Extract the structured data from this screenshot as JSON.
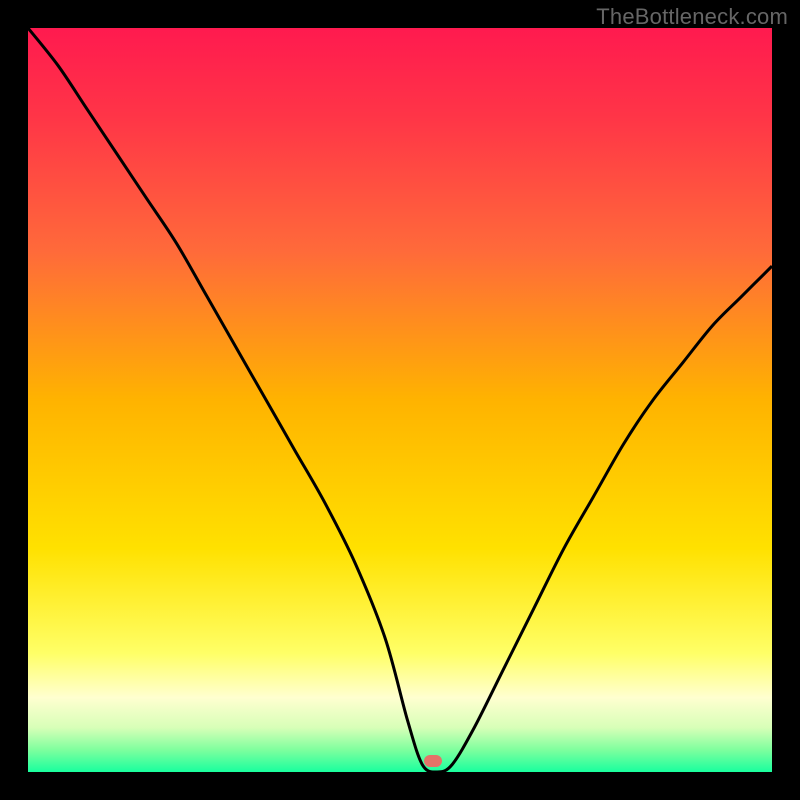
{
  "watermark": "TheBottleneck.com",
  "colors": {
    "background": "#000000",
    "gradient_stops": [
      {
        "offset": 0.0,
        "color": "#ff1a4f"
      },
      {
        "offset": 0.12,
        "color": "#ff3547"
      },
      {
        "offset": 0.3,
        "color": "#ff6a3a"
      },
      {
        "offset": 0.5,
        "color": "#ffb300"
      },
      {
        "offset": 0.7,
        "color": "#ffe100"
      },
      {
        "offset": 0.84,
        "color": "#ffff66"
      },
      {
        "offset": 0.9,
        "color": "#ffffd0"
      },
      {
        "offset": 0.94,
        "color": "#d8ffb8"
      },
      {
        "offset": 0.97,
        "color": "#7fff9e"
      },
      {
        "offset": 1.0,
        "color": "#19ff9e"
      }
    ],
    "curve": "#000000",
    "marker": "#e57368"
  },
  "marker": {
    "x_pct": 54.5,
    "y_pct": 98.5
  },
  "chart_data": {
    "type": "line",
    "title": "",
    "xlabel": "",
    "ylabel": "",
    "xlim": [
      0,
      100
    ],
    "ylim": [
      0,
      100
    ],
    "series": [
      {
        "name": "bottleneck-curve",
        "x": [
          0,
          4,
          8,
          12,
          16,
          20,
          24,
          28,
          32,
          36,
          40,
          44,
          48,
          51,
          53,
          55,
          57,
          60,
          64,
          68,
          72,
          76,
          80,
          84,
          88,
          92,
          96,
          100
        ],
        "y": [
          100,
          95,
          89,
          83,
          77,
          71,
          64,
          57,
          50,
          43,
          36,
          28,
          18,
          7,
          1,
          0,
          1,
          6,
          14,
          22,
          30,
          37,
          44,
          50,
          55,
          60,
          64,
          68
        ]
      }
    ],
    "annotations": [
      {
        "type": "marker",
        "x": 54.5,
        "y": 1.5,
        "label": "optimal-point"
      }
    ]
  }
}
